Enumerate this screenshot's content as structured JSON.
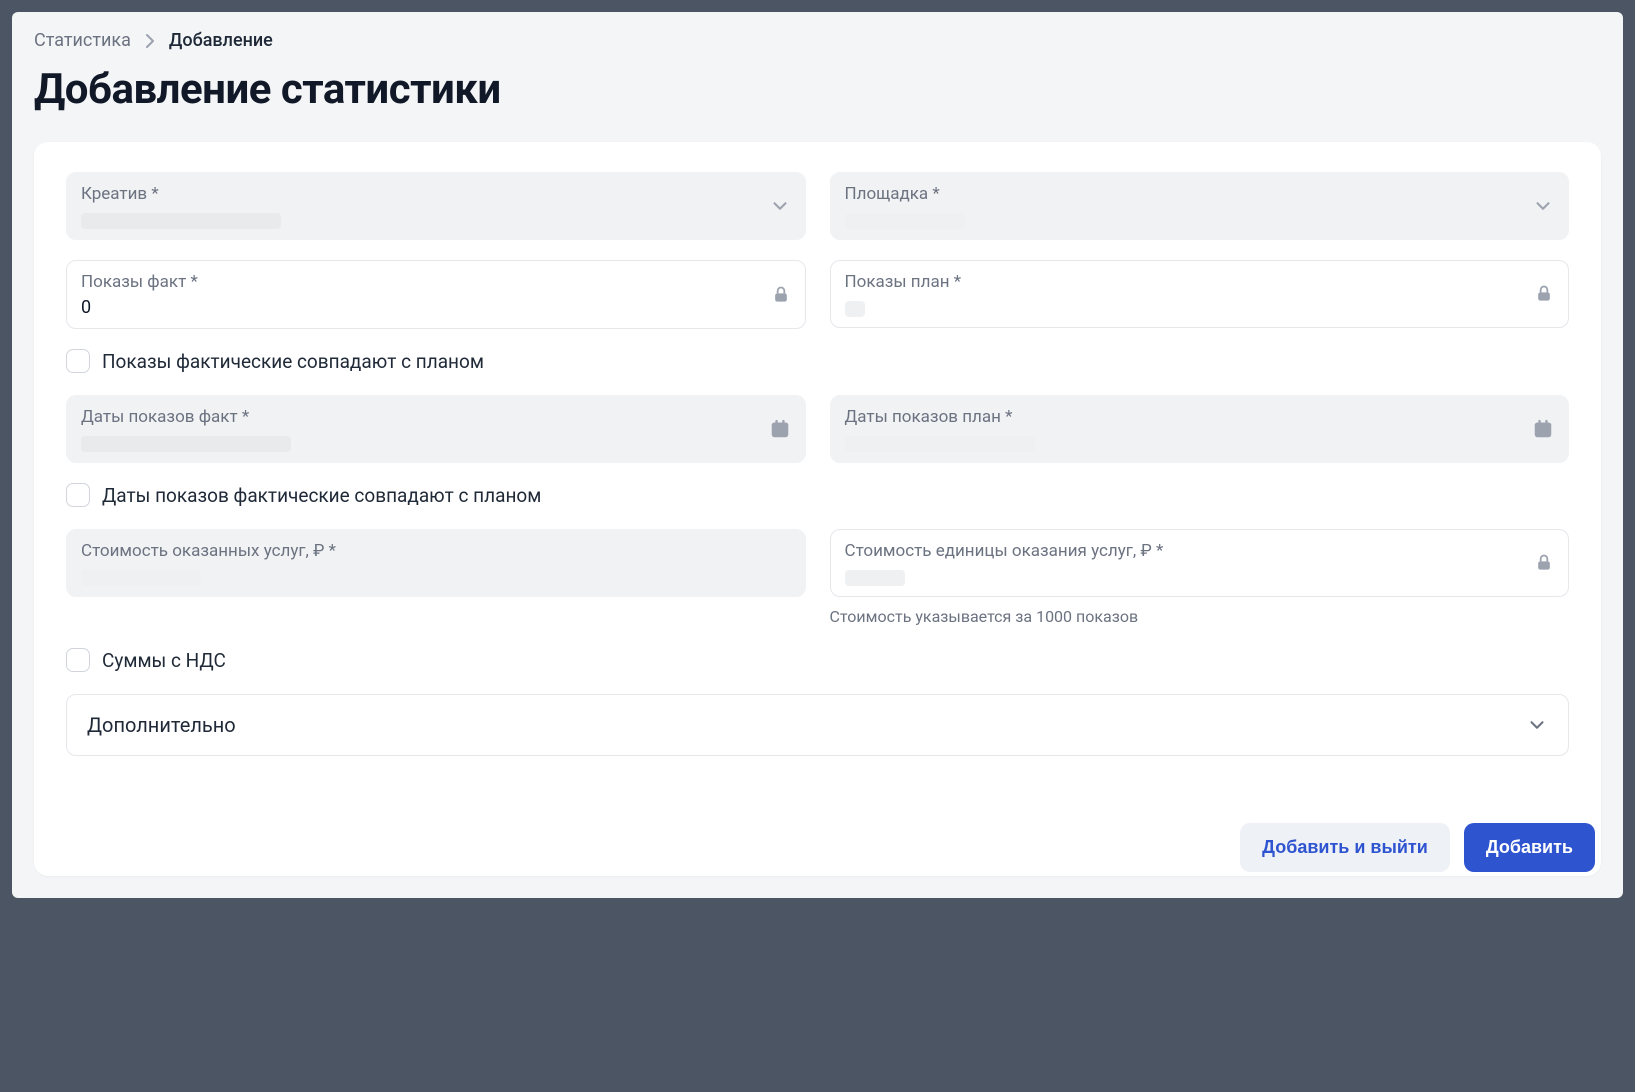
{
  "breadcrumb": {
    "root": "Статистика",
    "current": "Добавление"
  },
  "title": "Добавление статистики",
  "fields": {
    "creative_label": "Креатив *",
    "platform_label": "Площадка *",
    "impressions_fact_label": "Показы факт *",
    "impressions_fact_value": "0",
    "impressions_plan_label": "Показы план *",
    "dates_fact_label": "Даты показов факт *",
    "dates_plan_label": "Даты показов план *",
    "cost_services_label": "Стоимость оказанных услуг, ₽ *",
    "cost_unit_label": "Стоимость единицы оказания услуг, ₽ *",
    "cost_unit_helper": "Стоимость указывается за 1000 показов"
  },
  "checkboxes": {
    "impressions_match": "Показы фактические совпадают с планом",
    "dates_match": "Даты показов фактические совпадают с планом",
    "vat": "Суммы с НДС"
  },
  "accordion": {
    "extra": "Дополнительно"
  },
  "buttons": {
    "add_exit": "Добавить и выйти",
    "add": "Добавить"
  }
}
